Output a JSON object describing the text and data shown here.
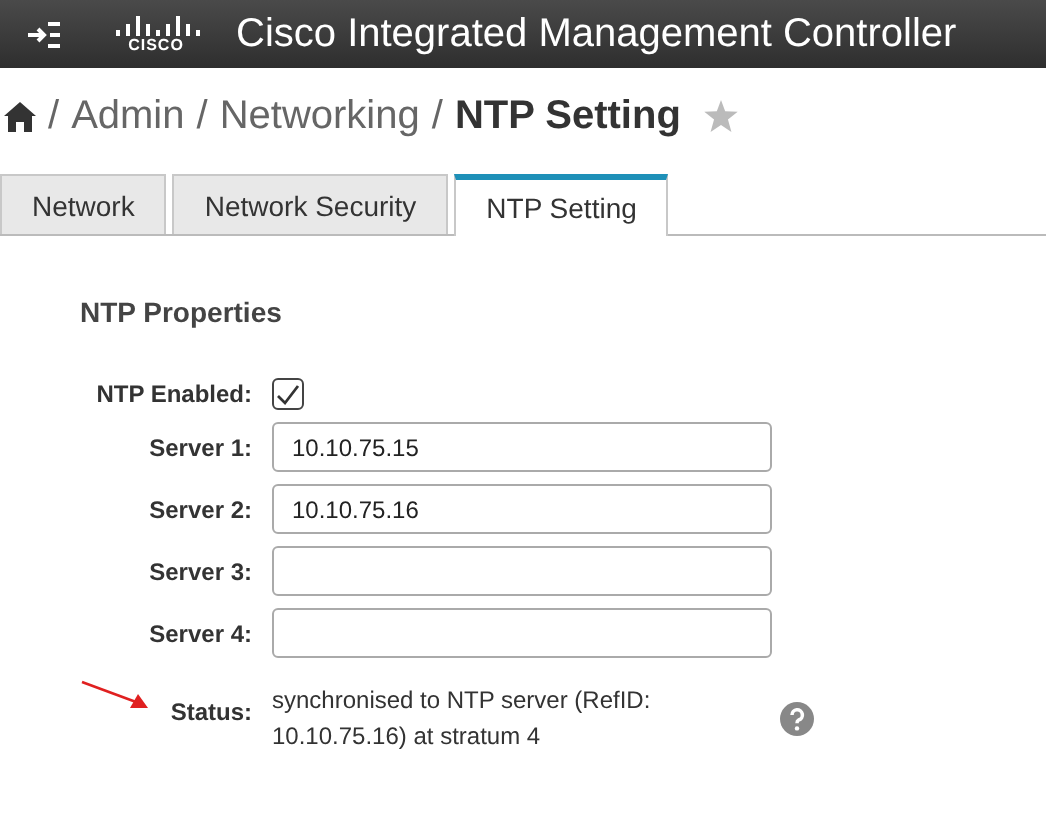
{
  "header": {
    "title": "Cisco Integrated Management Controller",
    "logo_text": "CISCO"
  },
  "breadcrumb": {
    "items": [
      "Admin",
      "Networking"
    ],
    "current": "NTP Setting",
    "separator": "/"
  },
  "tabs": [
    {
      "label": "Network",
      "selected": false
    },
    {
      "label": "Network Security",
      "selected": false
    },
    {
      "label": "NTP Setting",
      "selected": true
    }
  ],
  "section": {
    "title": "NTP Properties"
  },
  "fields": [
    {
      "kind": "checkbox",
      "label": "NTP Enabled:",
      "checked": true
    },
    {
      "kind": "input",
      "label": "Server 1:",
      "value": "10.10.75.15"
    },
    {
      "kind": "input",
      "label": "Server 2:",
      "value": "10.10.75.16"
    },
    {
      "kind": "input",
      "label": "Server 3:"
    },
    {
      "kind": "input",
      "label": "Server 4:"
    },
    {
      "kind": "status",
      "label": "Status:",
      "value": "synchronised to NTP server (RefID: 10.10.75.16) at stratum 4",
      "annotated": true
    }
  ]
}
